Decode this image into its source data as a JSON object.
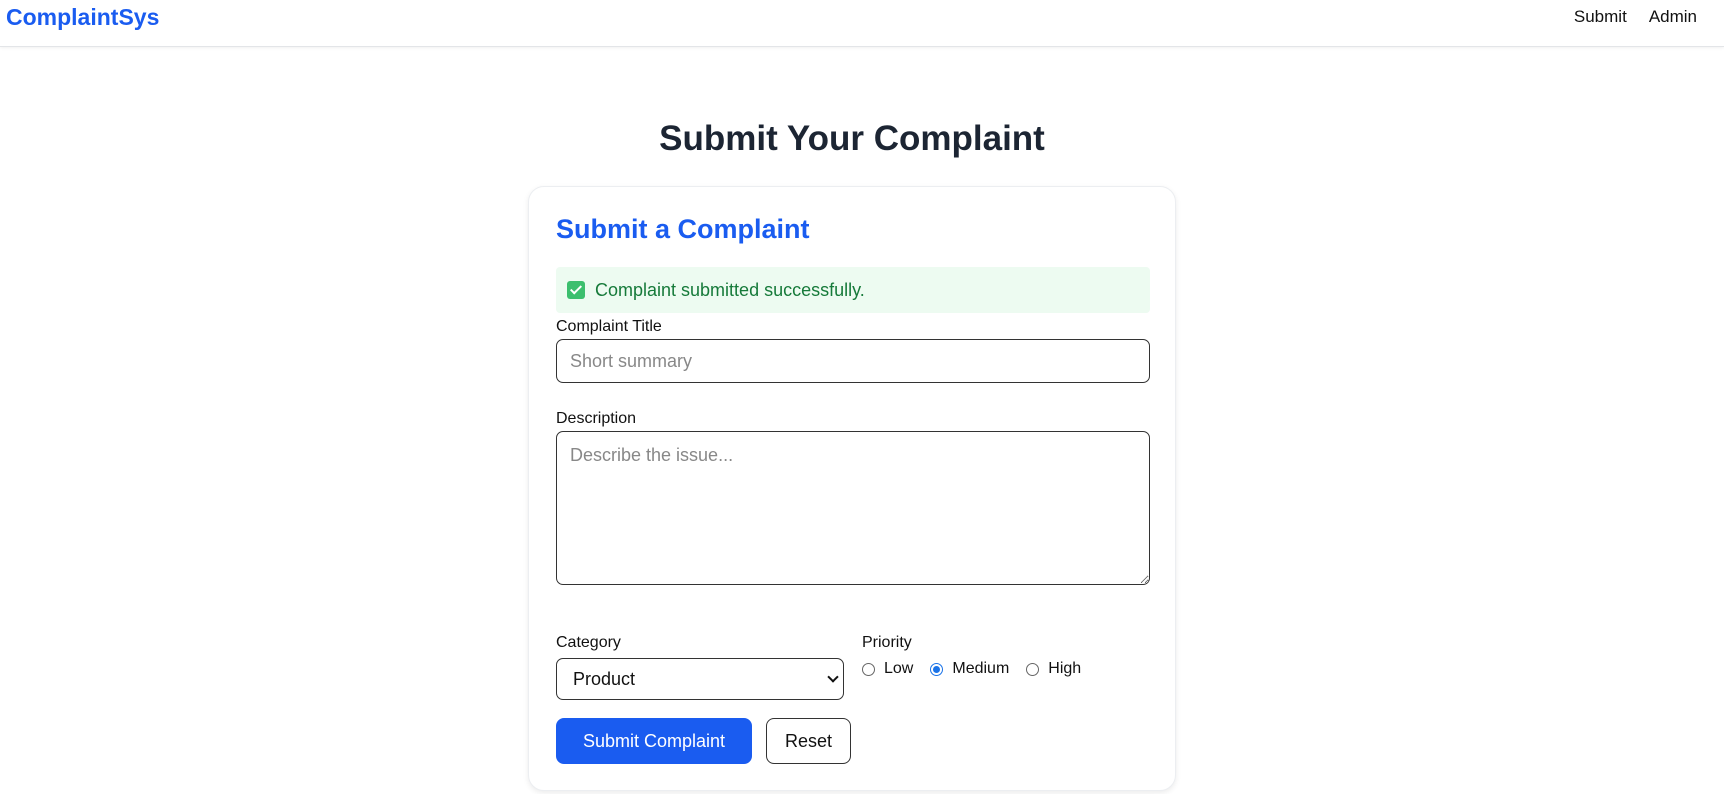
{
  "header": {
    "brand": "ComplaintSys",
    "nav": [
      {
        "label": "Submit"
      },
      {
        "label": "Admin"
      }
    ]
  },
  "page_title": "Submit Your Complaint",
  "card": {
    "title": "Submit a Complaint",
    "alert": {
      "icon": "check-square-icon",
      "text": "Complaint submitted successfully."
    },
    "title_field": {
      "label": "Complaint Title",
      "value": "",
      "placeholder": "Short summary"
    },
    "description_field": {
      "label": "Description",
      "value": "",
      "placeholder": "Describe the issue..."
    },
    "category": {
      "label": "Category",
      "selected": "Product"
    },
    "priority": {
      "label": "Priority",
      "options": [
        {
          "label": "Low",
          "checked": false
        },
        {
          "label": "Medium",
          "checked": true
        },
        {
          "label": "High",
          "checked": false
        }
      ]
    },
    "buttons": {
      "submit": "Submit Complaint",
      "reset": "Reset"
    }
  },
  "colors": {
    "accent": "#1a5cf0",
    "success_bg": "#edfbf1",
    "success_text": "#167a3a",
    "heading": "#1c2533"
  }
}
